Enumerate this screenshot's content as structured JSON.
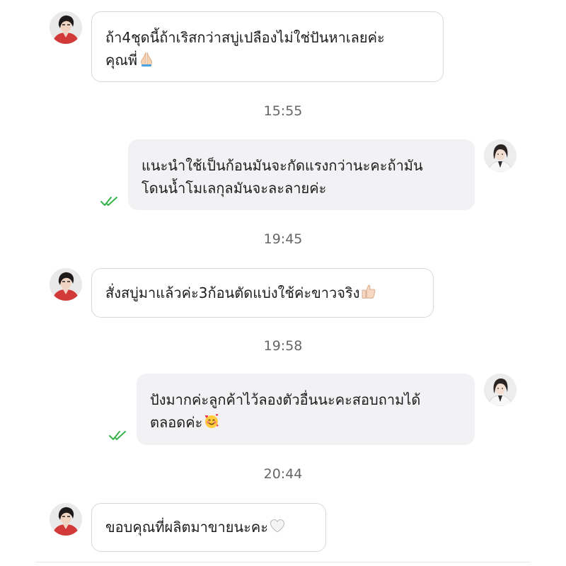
{
  "messages": [
    {
      "lines": [
        "ถ้า4ชุดนี้ถ้าเริสกว่าสบู่เปลืองไม่ใช่ปันหาเลยค่ะ",
        "คุณพี่"
      ],
      "emoji": "folded-hands-icon"
    },
    {
      "time": "15:55"
    },
    {
      "lines": [
        "แนะนำใช้เป็นก้อนมันจะกัดแรงกว่านะคะถ้ามัน",
        "โดนน้ำโมเลกุลมันจะละลายค่ะ"
      ]
    },
    {
      "time": "19:45"
    },
    {
      "lines": [
        "สั่งสบู่มาแล้วค่ะ3ก้อนตัดแบ่งใช้ค่ะขาวจริง"
      ],
      "emoji": "thumbs-up-icon"
    },
    {
      "time": "19:58"
    },
    {
      "lines": [
        "ปังมากค่ะลูกค้าไว้ลองตัวอื่นนะคะสอบถามได้",
        "ตลอดค่ะ"
      ],
      "emoji": "smiling-face-with-hearts-icon"
    },
    {
      "time": "20:44"
    },
    {
      "lines": [
        "ขอบคุณที่ผลิตมาขายนะคะ"
      ],
      "emoji": "white-heart-icon"
    }
  ],
  "colors": {
    "read_check": "#36b24a",
    "customer_top": "#d23a3a",
    "seller_top": "#f4f4f4"
  }
}
